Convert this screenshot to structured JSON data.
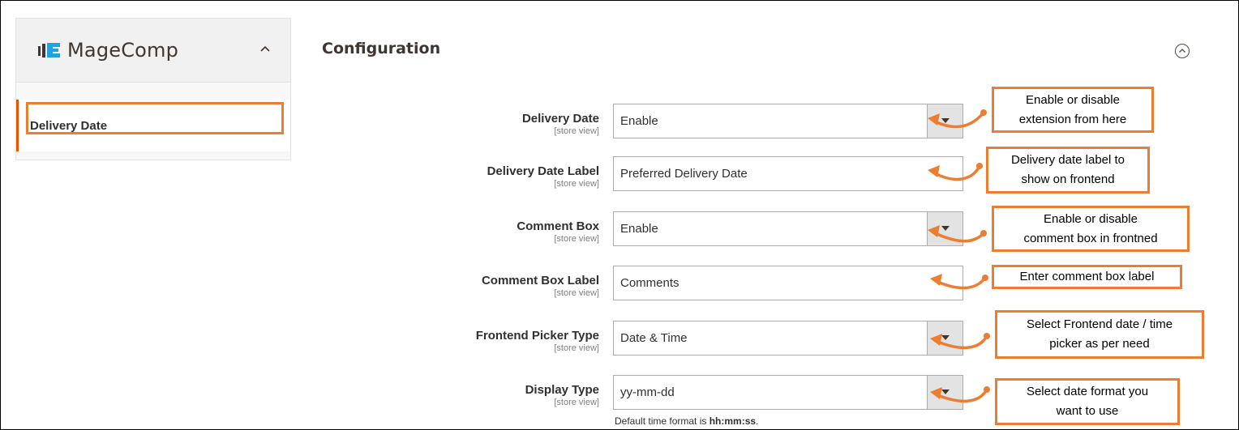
{
  "sidebar": {
    "brand": "MageComp",
    "active_item": "Delivery Date"
  },
  "main": {
    "title": "Configuration",
    "fields": [
      {
        "label": "Delivery Date",
        "scope": "[store view]",
        "value": "Enable",
        "type": "select"
      },
      {
        "label": "Delivery Date Label",
        "scope": "[store view]",
        "value": "Preferred Delivery Date",
        "type": "text"
      },
      {
        "label": "Comment Box",
        "scope": "[store view]",
        "value": "Enable",
        "type": "select"
      },
      {
        "label": "Comment Box Label",
        "scope": "[store view]",
        "value": "Comments",
        "type": "text"
      },
      {
        "label": "Frontend Picker Type",
        "scope": "[store view]",
        "value": "Date & Time",
        "type": "select"
      },
      {
        "label": "Display Type",
        "scope": "[store view]",
        "value": "yy-mm-dd",
        "type": "select"
      }
    ],
    "display_type_note_prefix": "Default time format is ",
    "display_type_note_bold": "hh:mm:ss",
    "display_type_note_suffix": "."
  },
  "callouts": [
    {
      "line1": "Enable or disable",
      "line2": "extension from here"
    },
    {
      "line1": "Delivery date label to",
      "line2": "show on frontend"
    },
    {
      "line1": "Enable or disable",
      "line2": "comment box in frontned"
    },
    {
      "line1": "Enter comment box label",
      "line2": ""
    },
    {
      "line1": "Select Frontend date / time",
      "line2": "picker as per need"
    },
    {
      "line1": "Select date format you",
      "line2": "want to use"
    }
  ],
  "colors": {
    "accent": "#eb5202",
    "callout": "#ed7d31"
  }
}
